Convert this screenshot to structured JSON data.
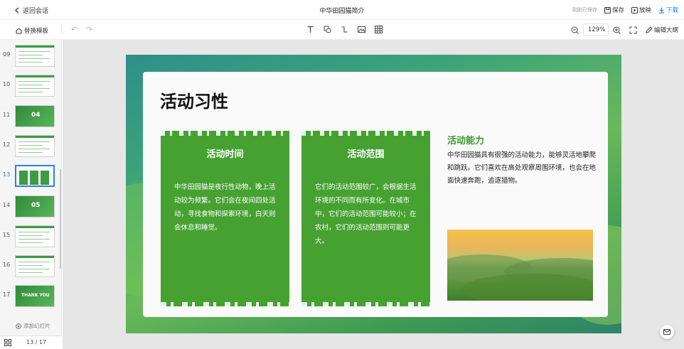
{
  "topbar": {
    "back_label": "返回会话",
    "doc_title": "中华田园猫简介",
    "autosave": "刚刚已保存",
    "save_label": "保存",
    "play_label": "放映",
    "download_label": "下载"
  },
  "toolbar": {
    "template_label": "替换模板",
    "zoom": "129%",
    "edit_outline_label": "编辑大纲"
  },
  "sidebar": {
    "slides": [
      {
        "num": "09",
        "style": "text"
      },
      {
        "num": "10",
        "style": "text"
      },
      {
        "num": "11",
        "style": "section",
        "big": "04"
      },
      {
        "num": "12",
        "style": "text"
      },
      {
        "num": "13",
        "style": "columns",
        "active": true
      },
      {
        "num": "14",
        "style": "section",
        "big": "05"
      },
      {
        "num": "15",
        "style": "text"
      },
      {
        "num": "16",
        "style": "text"
      },
      {
        "num": "17",
        "style": "thanks",
        "big": "THANK YOU"
      }
    ],
    "add_slide_label": "添加幻灯片",
    "page_indicator": "13 / 17"
  },
  "slide": {
    "heading": "活动习性",
    "col1": {
      "title": "活动时间",
      "text": "中华田园猫是夜行性动物，晚上活动较为频繁。它们会在夜间四处活动，寻找食物和探索环境，白天则会休息和睡觉。"
    },
    "col2": {
      "title": "活动范围",
      "text": "它们的活动范围较广，会根据生活环境的不同而有所变化。在城市中，它们的活动范围可能较小；在农村，它们的活动范围则可能更大。"
    },
    "ability": {
      "title": "活动能力",
      "text": "中华田园猫具有很强的活动能力，能够灵活地攀爬和跳跃。它们喜欢在高处观察周围环境，也会在地面快速奔跑，追逐猎物。"
    }
  },
  "colors": {
    "accent": "#1e7be6",
    "slide_green": "#46a131",
    "ability_title": "#3a9a2c"
  }
}
